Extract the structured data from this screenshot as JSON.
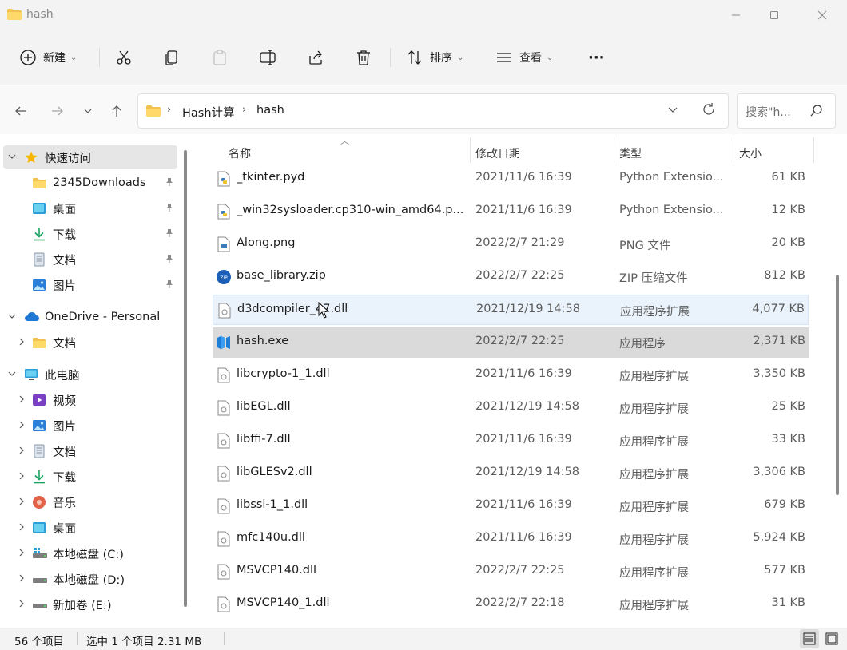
{
  "window": {
    "title": "hash",
    "minimize": "—",
    "maximize": "☐",
    "close": "✕"
  },
  "toolbar": {
    "new_label": "新建",
    "sort_label": "排序",
    "view_label": "查看",
    "more": "···"
  },
  "address": {
    "crumbs": [
      "Hash计算",
      "hash"
    ],
    "search_placeholder": "搜索\"h..."
  },
  "sidebar": {
    "items": [
      {
        "label": "快速访问",
        "icon": "star-icon",
        "level": 0,
        "expanded": true,
        "selected": true
      },
      {
        "label": "2345Downloads",
        "icon": "folder-icon",
        "level": 1,
        "pinned": true
      },
      {
        "label": "桌面",
        "icon": "desktop-icon",
        "level": 1,
        "pinned": true
      },
      {
        "label": "下载",
        "icon": "download-icon",
        "level": 1,
        "pinned": true
      },
      {
        "label": "文档",
        "icon": "document-icon",
        "level": 1,
        "pinned": true
      },
      {
        "label": "图片",
        "icon": "pictures-icon",
        "level": 1,
        "pinned": true
      },
      {
        "label": "OneDrive - Personal",
        "icon": "cloud-icon",
        "level": 0,
        "expanded": true
      },
      {
        "label": "文档",
        "icon": "folder-icon",
        "level": 1,
        "collapsed": true
      },
      {
        "label": "此电脑",
        "icon": "computer-icon",
        "level": 0,
        "expanded": true
      },
      {
        "label": "视频",
        "icon": "video-icon",
        "level": 1,
        "collapsed": true
      },
      {
        "label": "图片",
        "icon": "pictures-icon",
        "level": 1,
        "collapsed": true
      },
      {
        "label": "文档",
        "icon": "document-icon",
        "level": 1,
        "collapsed": true
      },
      {
        "label": "下载",
        "icon": "download-icon",
        "level": 1,
        "collapsed": true
      },
      {
        "label": "音乐",
        "icon": "music-icon",
        "level": 1,
        "collapsed": true
      },
      {
        "label": "桌面",
        "icon": "desktop-icon",
        "level": 1,
        "collapsed": true
      },
      {
        "label": "本地磁盘 (C:)",
        "icon": "drive-c-icon",
        "level": 1,
        "collapsed": true
      },
      {
        "label": "本地磁盘 (D:)",
        "icon": "drive-icon",
        "level": 1,
        "collapsed": true
      },
      {
        "label": "新加卷 (E:)",
        "icon": "drive-icon",
        "level": 1,
        "collapsed": true
      }
    ]
  },
  "columns": {
    "name": "名称",
    "date": "修改日期",
    "type": "类型",
    "size": "大小"
  },
  "files": [
    {
      "name": "_tkinter.pyd",
      "date": "2021/11/6 16:39",
      "type": "Python Extensio...",
      "size": "61 KB",
      "icon": "python-file-icon"
    },
    {
      "name": "_win32sysloader.cp310-win_amd64.p...",
      "date": "2021/11/6 16:39",
      "type": "Python Extensio...",
      "size": "12 KB",
      "icon": "python-file-icon"
    },
    {
      "name": "Along.png",
      "date": "2022/2/7 21:29",
      "type": "PNG 文件",
      "size": "20 KB",
      "icon": "image-file-icon"
    },
    {
      "name": "base_library.zip",
      "date": "2022/2/7 22:25",
      "type": "ZIP 压缩文件",
      "size": "812 KB",
      "icon": "zip-file-icon"
    },
    {
      "name": "d3dcompiler_47.dll",
      "date": "2021/12/19 14:58",
      "type": "应用程序扩展",
      "size": "4,077 KB",
      "icon": "dll-file-icon",
      "state": "hover"
    },
    {
      "name": "hash.exe",
      "date": "2022/2/7 22:25",
      "type": "应用程序",
      "size": "2,371 KB",
      "icon": "exe-file-icon",
      "state": "selected"
    },
    {
      "name": "libcrypto-1_1.dll",
      "date": "2021/11/6 16:39",
      "type": "应用程序扩展",
      "size": "3,350 KB",
      "icon": "dll-file-icon"
    },
    {
      "name": "libEGL.dll",
      "date": "2021/12/19 14:58",
      "type": "应用程序扩展",
      "size": "25 KB",
      "icon": "dll-file-icon"
    },
    {
      "name": "libffi-7.dll",
      "date": "2021/11/6 16:39",
      "type": "应用程序扩展",
      "size": "33 KB",
      "icon": "dll-file-icon"
    },
    {
      "name": "libGLESv2.dll",
      "date": "2021/12/19 14:58",
      "type": "应用程序扩展",
      "size": "3,306 KB",
      "icon": "dll-file-icon"
    },
    {
      "name": "libssl-1_1.dll",
      "date": "2021/11/6 16:39",
      "type": "应用程序扩展",
      "size": "679 KB",
      "icon": "dll-file-icon"
    },
    {
      "name": "mfc140u.dll",
      "date": "2021/11/6 16:39",
      "type": "应用程序扩展",
      "size": "5,924 KB",
      "icon": "dll-file-icon"
    },
    {
      "name": "MSVCP140.dll",
      "date": "2022/2/7 22:25",
      "type": "应用程序扩展",
      "size": "577 KB",
      "icon": "dll-file-icon"
    },
    {
      "name": "MSVCP140_1.dll",
      "date": "2022/2/7 22:18",
      "type": "应用程序扩展",
      "size": "31 KB",
      "icon": "dll-file-icon"
    }
  ],
  "status": {
    "item_count": "56 个项目",
    "selection": "选中 1 个项目  2.31 MB"
  }
}
